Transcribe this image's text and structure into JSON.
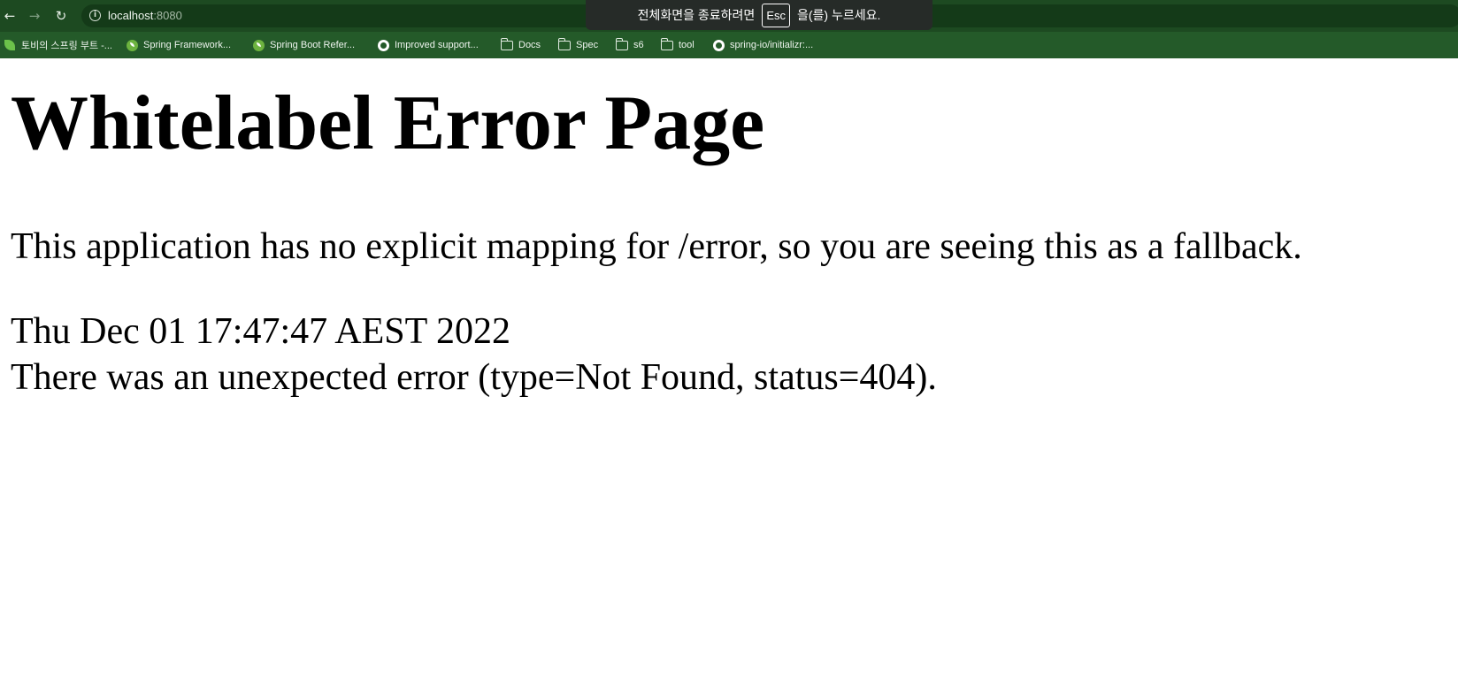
{
  "browser": {
    "url_host": "localhost",
    "url_port": ":8080",
    "bookmarks": [
      {
        "icon": "leaf-icon",
        "label": "토비의 스프링 부트 -..."
      },
      {
        "icon": "spring-icon",
        "label": "Spring Framework..."
      },
      {
        "icon": "spring-icon",
        "label": "Spring Boot Refer..."
      },
      {
        "icon": "github-icon",
        "label": "Improved support..."
      },
      {
        "icon": "folder-icon",
        "label": "Docs"
      },
      {
        "icon": "folder-icon",
        "label": "Spec"
      },
      {
        "icon": "folder-icon",
        "label": "s6"
      },
      {
        "icon": "folder-icon",
        "label": "tool"
      },
      {
        "icon": "github-icon",
        "label": "spring-io/initializr:..."
      }
    ]
  },
  "fullscreen_notice": {
    "before": "전체화면을 종료하려면",
    "key": "Esc",
    "after": "을(를) 누르세요."
  },
  "page": {
    "title": "Whitelabel Error Page",
    "message": "This application has no explicit mapping for /error, so you are seeing this as a fallback.",
    "timestamp": "Thu Dec 01 17:47:47 AEST 2022",
    "error": "There was an unexpected error (type=Not Found, status=404)."
  },
  "colors": {
    "toolbar": "#1d4a21",
    "bookmarks_bar": "#245a29",
    "spring_green": "#6db33f"
  }
}
